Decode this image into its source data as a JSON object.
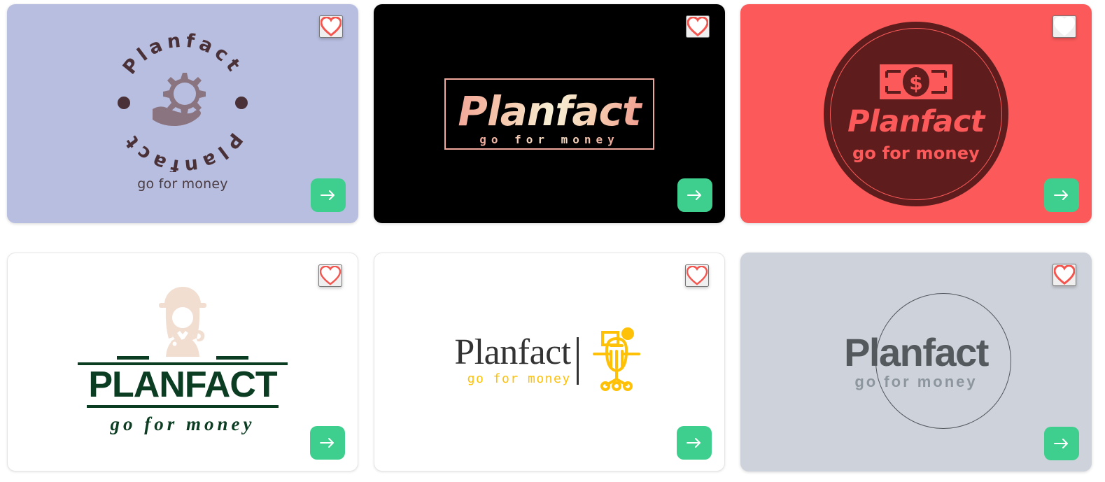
{
  "brand": {
    "name": "Planfact",
    "name_upper": "PLANFACT",
    "tagline": "go for money"
  },
  "colors": {
    "accent_green": "#3ecf8e",
    "heart_red": "#f4554f",
    "card1_bg": "#b8bee0",
    "card1_ink": "#4a3c42",
    "card2_bg": "#000000",
    "card2_ink": "#f0a79c",
    "card3_bg": "#fc5a5a",
    "card3_coin": "#5e1c1c",
    "card4_ink": "#0b3d22",
    "card4_icon": "#f2ded1",
    "card5_ink": "#333333",
    "card5_accent": "#ffc107",
    "card6_bg": "#ced2da",
    "card6_ink": "#54595e",
    "card6_sub": "#8d969e"
  },
  "icons": {
    "favorite": "heart-icon",
    "next": "arrow-right-icon",
    "card1_symbol": "gear-in-hand-icon",
    "card3_symbol": "dollar-banknote-icon",
    "card4_symbol": "worker-with-wrench-icon",
    "card5_symbol": "office-chair-icon",
    "card6_symbol": "circle-outline-icon"
  },
  "cards": [
    {
      "id": "card-1",
      "style": "circular-badge",
      "title": "Planfact",
      "title_repeat": "Planfact",
      "tagline": "go for money",
      "favorite": true,
      "favorite_state": "filled",
      "bg": "#b8bee0"
    },
    {
      "id": "card-2",
      "style": "black-framed-gradient",
      "title": "Planfact",
      "tagline": "go for money",
      "favorite": true,
      "favorite_state": "filled",
      "bg": "#000000"
    },
    {
      "id": "card-3",
      "style": "red-coin",
      "title": "Planfact",
      "tagline": "go for money",
      "favorite": true,
      "favorite_state": "filled",
      "bg": "#fc5a5a"
    },
    {
      "id": "card-4",
      "style": "white-green-block",
      "title": "PLANFACT",
      "tagline": "go for money",
      "favorite": true,
      "favorite_state": "outline",
      "bg": "#ffffff"
    },
    {
      "id": "card-5",
      "style": "white-serif-chair",
      "title": "Planfact",
      "tagline": "go for money",
      "favorite": true,
      "favorite_state": "outline",
      "bg": "#ffffff"
    },
    {
      "id": "card-6",
      "style": "grey-circle",
      "title": "Planfact",
      "tagline": "go for money",
      "favorite": true,
      "favorite_state": "filled",
      "bg": "#ced2da"
    }
  ]
}
